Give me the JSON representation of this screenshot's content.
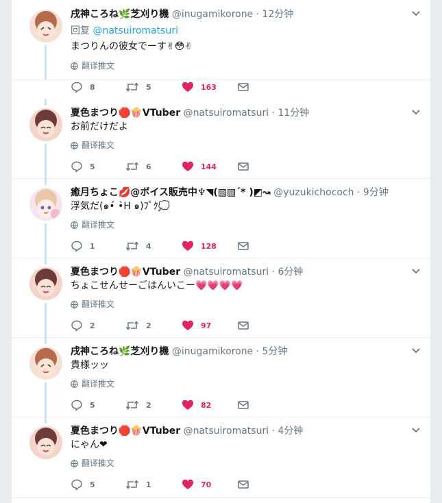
{
  "labels": {
    "reply_prefix": "回复",
    "translate": "翻译推文"
  },
  "colors": {
    "accent": "#1da1f2",
    "like": "#e0245e",
    "thread_line": "#c5e6f8",
    "secondary_text": "#657786"
  },
  "icons": {
    "reply": "reply-icon",
    "retweet": "retweet-icon",
    "like": "heart-icon",
    "dm": "envelope-icon",
    "translate": "globe-icon",
    "menu": "chevron-down-icon"
  },
  "tweets": [
    {
      "name": "戌神ころね🌿芝刈り機",
      "handle": "@inugamikorone",
      "time": "· 12分钟",
      "reply_to": "@natsuiromatsuri",
      "text": "まつりんの彼女でーす✌😳✌",
      "replies": "8",
      "retweets": "5",
      "likes": "163",
      "avatar_color": "#b46a4b"
    },
    {
      "name": "夏色まつり🛑🍿VTuber",
      "handle": "@natsuiromatsuri",
      "time": "· 11分钟",
      "text": "お前だけだよ",
      "replies": "5",
      "retweets": "6",
      "likes": "144",
      "avatar_color": "#6d3b38"
    },
    {
      "name": "癒月ちょこ💋@ボイス販売中♆◥(▧▧´* )◩↝",
      "handle": "@yuzukichococh",
      "time": "· 9分钟",
      "text": "浮気だ(๑•́ •̀H ๑)ﾌﾟｸ💭",
      "replies": "1",
      "retweets": "4",
      "likes": "128",
      "avatar_color": "#e9c7a8"
    },
    {
      "name": "夏色まつり🛑🍿VTuber",
      "handle": "@natsuiromatsuri",
      "time": "· 6分钟",
      "text": "ちょこせんせーごはんいこー💗💗💗💗",
      "replies": "2",
      "retweets": "2",
      "likes": "97",
      "avatar_color": "#6d3b38"
    },
    {
      "name": "戌神ころね🌿芝刈り機",
      "handle": "@inugamikorone",
      "time": "· 5分钟",
      "text": "貴様ッッ",
      "replies": "5",
      "retweets": "2",
      "likes": "82",
      "avatar_color": "#b46a4b"
    },
    {
      "name": "夏色まつり🛑🍿VTuber",
      "handle": "@natsuiromatsuri",
      "time": "· 4分钟",
      "text": "にゃん❤",
      "replies": "5",
      "retweets": "1",
      "likes": "70",
      "avatar_color": "#6d3b38"
    }
  ]
}
